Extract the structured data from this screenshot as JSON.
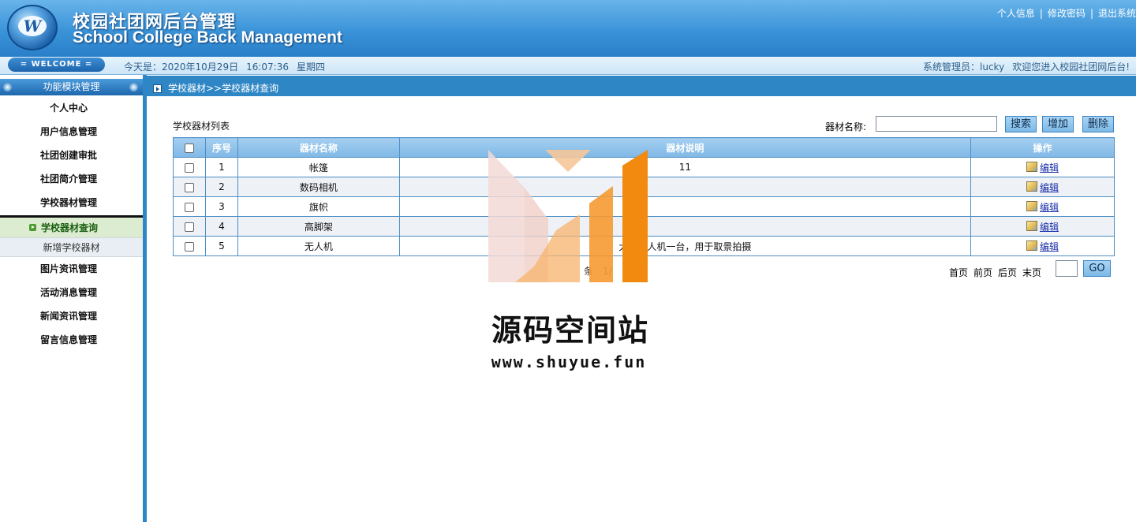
{
  "header": {
    "title_cn": "校园社团网后台管理",
    "title_en": "School College Back Management",
    "logo_letter": "W",
    "links": [
      "个人信息",
      "修改密码",
      "退出系统"
    ],
    "separator": "|"
  },
  "welcome": {
    "badge": "= WELCOME =",
    "date": "今天是：2020年10月29日",
    "time": "16:07:36",
    "weekday": "星期四",
    "admin": "系统管理员：lucky",
    "greeting": "欢迎您进入校园社团网后台!"
  },
  "sidebar": {
    "header": "功能模块管理",
    "items": [
      "个人中心",
      "用户信息管理",
      "社团创建审批",
      "社团简介管理",
      "学校器材管理"
    ],
    "active_sub": "学校器材查询",
    "sub": "新增学校器材",
    "items_after": [
      "图片资讯管理",
      "活动消息管理",
      "新闻资讯管理",
      "留言信息管理"
    ]
  },
  "main": {
    "breadcrumb": "学校器材>>学校器材查询",
    "list_title": "学校器材列表",
    "search_label": "器材名称:",
    "search_value": "",
    "buttons": {
      "search": "搜索",
      "add": "增加",
      "delete": "删除"
    },
    "table": {
      "headers": [
        "",
        "序号",
        "器材名称",
        "器材说明",
        "操作"
      ],
      "rows": [
        {
          "no": "1",
          "name": "帐篷",
          "desc": "11",
          "action": "编辑"
        },
        {
          "no": "2",
          "name": "数码相机",
          "desc": "",
          "action": "编辑"
        },
        {
          "no": "3",
          "name": "旗帜",
          "desc": "",
          "action": "编辑"
        },
        {
          "no": "4",
          "name": "高脚架",
          "desc": "",
          "action": "编辑"
        },
        {
          "no": "5",
          "name": "无人机",
          "desc": "大　　人机一台，用于取景拍摄",
          "action": "编辑"
        }
      ]
    },
    "pager": {
      "info": "条　1/",
      "first": "首页",
      "prev": "前页",
      "next": "后页",
      "last": "末页",
      "page_value": "",
      "go": "GO"
    }
  },
  "watermark": {
    "text": "源码空间站",
    "url": "www.shuyue.fun"
  },
  "colors": {
    "header_blue": "#3a93d8",
    "sidebar_border": "#2d86c6",
    "table_header": "#7fb8e6",
    "link": "#1a2fa8",
    "watermark_orange": "#f28a10"
  }
}
